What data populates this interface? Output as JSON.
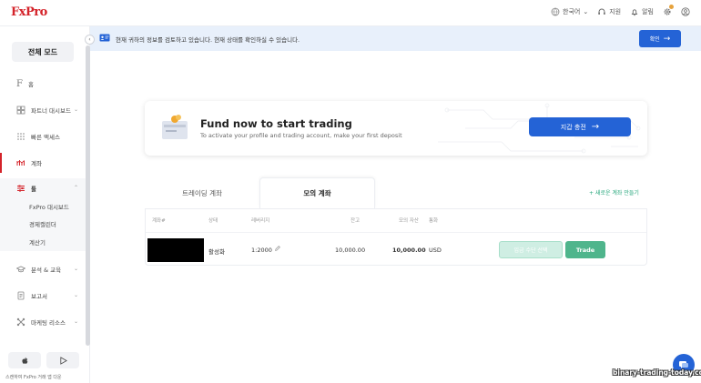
{
  "app": {
    "logo": "FxPro"
  },
  "topbar": {
    "language": "한국어",
    "support": "지원",
    "notifications": "알림"
  },
  "sidebar": {
    "mode_button": "전체 모드",
    "items": [
      {
        "label": "홈",
        "icon": "fxpro-f-icon"
      },
      {
        "label": "파트너 대시보드",
        "icon": "dashboard-icon"
      },
      {
        "label": "빠른 액세스",
        "icon": "grid-icon"
      },
      {
        "label": "계좌",
        "icon": "accounts-icon"
      },
      {
        "label": "툴",
        "icon": "tools-icon"
      },
      {
        "label": "분석 & 교육",
        "icon": "graduation-icon"
      },
      {
        "label": "보고서",
        "icon": "report-icon"
      },
      {
        "label": "마케팅 리소스",
        "icon": "marketing-icon"
      }
    ],
    "tools_sub": [
      "FxPro 대시보드",
      "경제캘린더",
      "계산기"
    ],
    "store_text": "스캔하여 FxPro 거래 앱 다운"
  },
  "banner": {
    "text": "현재 귀하의 정보를 검토하고 있습니다. 현재 상태를 확인하실 수 있습니다.",
    "button": "확인"
  },
  "fund_card": {
    "title": "Fund now to start trading",
    "subtitle": "To activate your profile and trading account, make your first deposit",
    "button": "지갑 충전"
  },
  "tabs": [
    "트레이딩 계좌",
    "모의 계좌"
  ],
  "active_tab": "모의 계좌",
  "new_account_link": "+ 새로운 계좌 만들기",
  "table": {
    "headers": [
      "계좌#",
      "상태",
      "레버리지",
      "잔고",
      "모의 자산",
      "통화"
    ],
    "row": {
      "status": "활성화",
      "leverage": "1:2000",
      "balance": "10,000.00",
      "equity": "10,000.00",
      "currency": "USD",
      "fund_method_button": "입금 수단 선택",
      "trade_button": "Trade"
    }
  },
  "watermark": "binary-trading-today.com",
  "colors": {
    "brand_red": "#d4232a",
    "primary_blue": "#2463d6",
    "trade_green": "#4fb58c"
  }
}
